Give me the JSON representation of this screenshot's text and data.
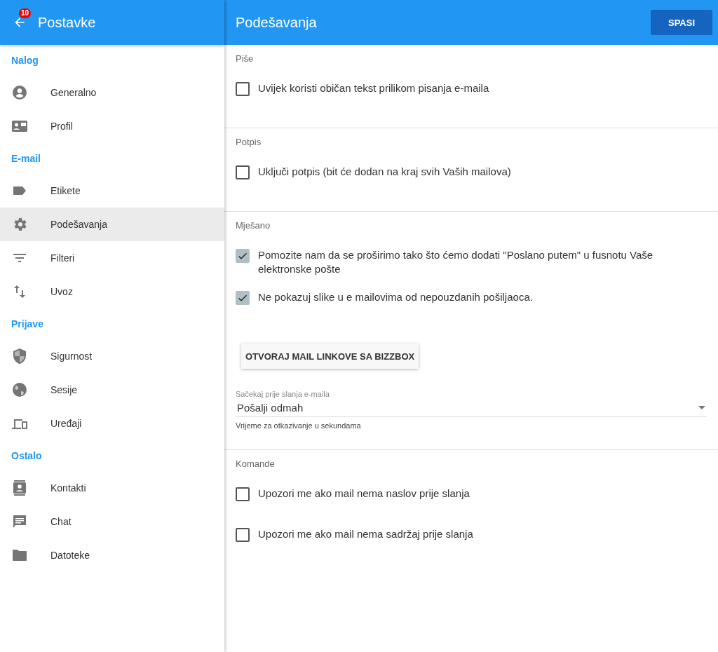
{
  "sidebar": {
    "title": "Postavke",
    "badge": "10",
    "groups": [
      {
        "title": "Nalog",
        "items": [
          {
            "label": "Generalno",
            "selected": false
          },
          {
            "label": "Profil",
            "selected": false
          }
        ]
      },
      {
        "title": "E-mail",
        "items": [
          {
            "label": "Etikete",
            "selected": false
          },
          {
            "label": "Podešavanja",
            "selected": true
          },
          {
            "label": "Filteri",
            "selected": false
          },
          {
            "label": "Uvoz",
            "selected": false
          }
        ]
      },
      {
        "title": "Prijave",
        "items": [
          {
            "label": "Sigurnost",
            "selected": false
          },
          {
            "label": "Sesije",
            "selected": false
          },
          {
            "label": "Uređaji",
            "selected": false
          }
        ]
      },
      {
        "title": "Ostalo",
        "items": [
          {
            "label": "Kontakti",
            "selected": false
          },
          {
            "label": "Chat",
            "selected": false
          },
          {
            "label": "Datoteke",
            "selected": false
          }
        ]
      }
    ]
  },
  "header": {
    "title": "Podešavanja",
    "save_button": "SPASI"
  },
  "sections": [
    {
      "title": "Piše",
      "items": [
        {
          "kind": "checkbox",
          "label": "Uvijek koristi običan tekst prilikom pisanja e-maila",
          "checked": false
        }
      ]
    },
    {
      "title": "Potpis",
      "items": [
        {
          "kind": "checkbox",
          "label": "Uključi potpis (bit će dodan na kraj svih Vaših mailova)",
          "checked": false
        }
      ]
    },
    {
      "title": "Mješano",
      "items": [
        {
          "kind": "checkbox",
          "label": "Pomozite nam da se proširimo tako što ćemo dodati \"Poslano putem\" u fusnotu Vaše elektronske pošte",
          "checked": true
        },
        {
          "kind": "checkbox",
          "label": "Ne pokazuj slike u e mailovima od nepouzdanih pošiljaoca.",
          "checked": true
        },
        {
          "kind": "button",
          "label": "OTVORAJ MAIL LINKOVE SA BIZZBOX"
        },
        {
          "kind": "select",
          "label": "Sačekaj prije slanja e-maila",
          "value": "Pošalji odmah",
          "helper": "Vrijeme za otkazivanje u sekundama"
        }
      ]
    },
    {
      "title": "Komande",
      "items": [
        {
          "kind": "checkbox",
          "label": "Upozori me ako mail nema naslov prije slanja",
          "checked": false
        },
        {
          "kind": "checkbox",
          "label": "Upozori me ako mail nema sadržaj prije slanja",
          "checked": false
        }
      ]
    }
  ]
}
